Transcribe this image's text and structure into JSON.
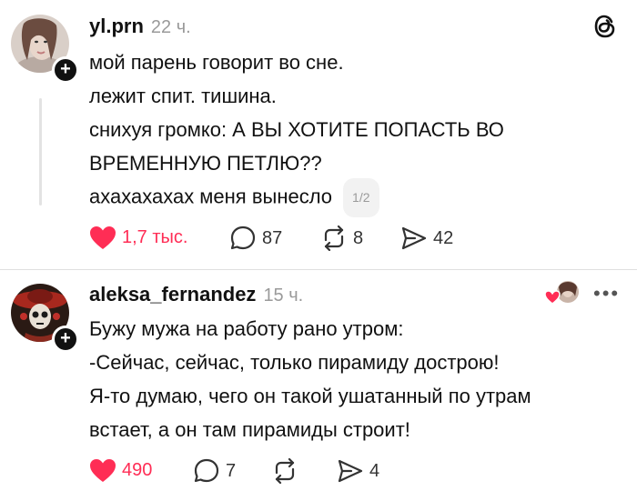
{
  "colors": {
    "like": "#ff2d55",
    "text": "#111111",
    "muted": "#9a9a9a",
    "divider": "#e0e0e0"
  },
  "app": {
    "logo_icon": "threads-logo-icon"
  },
  "posts": [
    {
      "username": "yl.prn",
      "time": "22 ч.",
      "lines": [
        "мой парень говорит во сне.",
        "лежит спит. тишина.",
        "снихуя громко: А ВЫ ХОТИТЕ ПОПАСТЬ ВО",
        "ВРЕМЕННУЮ ПЕТЛЮ??"
      ],
      "reply_text": "ахахахахах меня вынесло",
      "page_badge": "1/2",
      "likes": "1,7 тыс.",
      "comments": "87",
      "reposts": "8",
      "shares": "42"
    },
    {
      "username": "aleksa_fernandez",
      "time": "15 ч.",
      "lines": [
        "Бужу мужа на работу рано утром:",
        "-Сейчас, сейчас, только пирамиду дострою!",
        "Я-то думаю, чего он такой ушатанный по утрам",
        "встает, а он там пирамиды строит!"
      ],
      "likes": "490",
      "comments": "7",
      "reposts": "",
      "shares": "4"
    }
  ]
}
